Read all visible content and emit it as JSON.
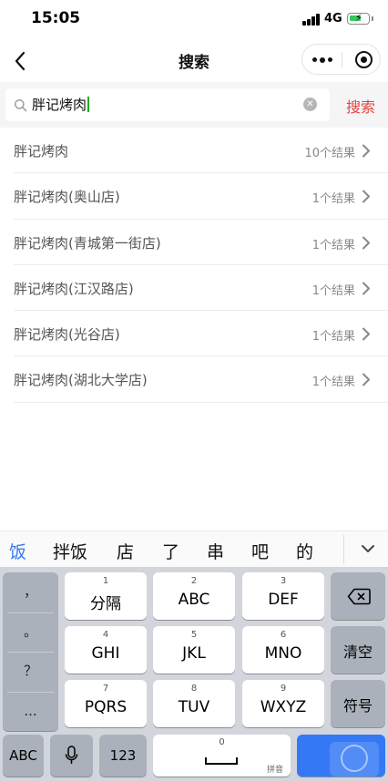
{
  "status_bar": {
    "time": "15:05",
    "network": "4G"
  },
  "nav_bar": {
    "title": "搜索",
    "back_icon": "chevron-left-icon",
    "more_icon": "more-dots-icon",
    "close_icon": "target-circle-icon"
  },
  "search": {
    "query": "胖记烤肉",
    "search_button_label": "搜索",
    "accent_color": "#e64340"
  },
  "results": [
    {
      "name": "胖记烤肉",
      "count": "10个结果"
    },
    {
      "name": "胖记烤肉(奥山店)",
      "count": "1个结果"
    },
    {
      "name": "胖记烤肉(青城第一街店)",
      "count": "1个结果"
    },
    {
      "name": "胖记烤肉(江汉路店)",
      "count": "1个结果"
    },
    {
      "name": "胖记烤肉(光谷店)",
      "count": "1个结果"
    },
    {
      "name": "胖记烤肉(湖北大学店)",
      "count": "1个结果"
    }
  ],
  "keyboard": {
    "candidates": [
      "饭",
      "拌饭",
      "店",
      "了",
      "串",
      "吧",
      "的"
    ],
    "punctuation": [
      "，",
      "。",
      "？",
      "..."
    ],
    "rows": [
      [
        {
          "num": "1",
          "label": "分隔"
        },
        {
          "num": "2",
          "label": "ABC"
        },
        {
          "num": "3",
          "label": "DEF"
        }
      ],
      [
        {
          "num": "4",
          "label": "GHI"
        },
        {
          "num": "5",
          "label": "JKL"
        },
        {
          "num": "6",
          "label": "MNO"
        }
      ],
      [
        {
          "num": "7",
          "label": "PQRS"
        },
        {
          "num": "8",
          "label": "TUV"
        },
        {
          "num": "9",
          "label": "WXYZ"
        }
      ]
    ],
    "clear_label": "清空",
    "symbol_label": "符号",
    "abc_label": "ABC",
    "num_label": "123",
    "space_num": "0",
    "space_sub": "拼音"
  }
}
